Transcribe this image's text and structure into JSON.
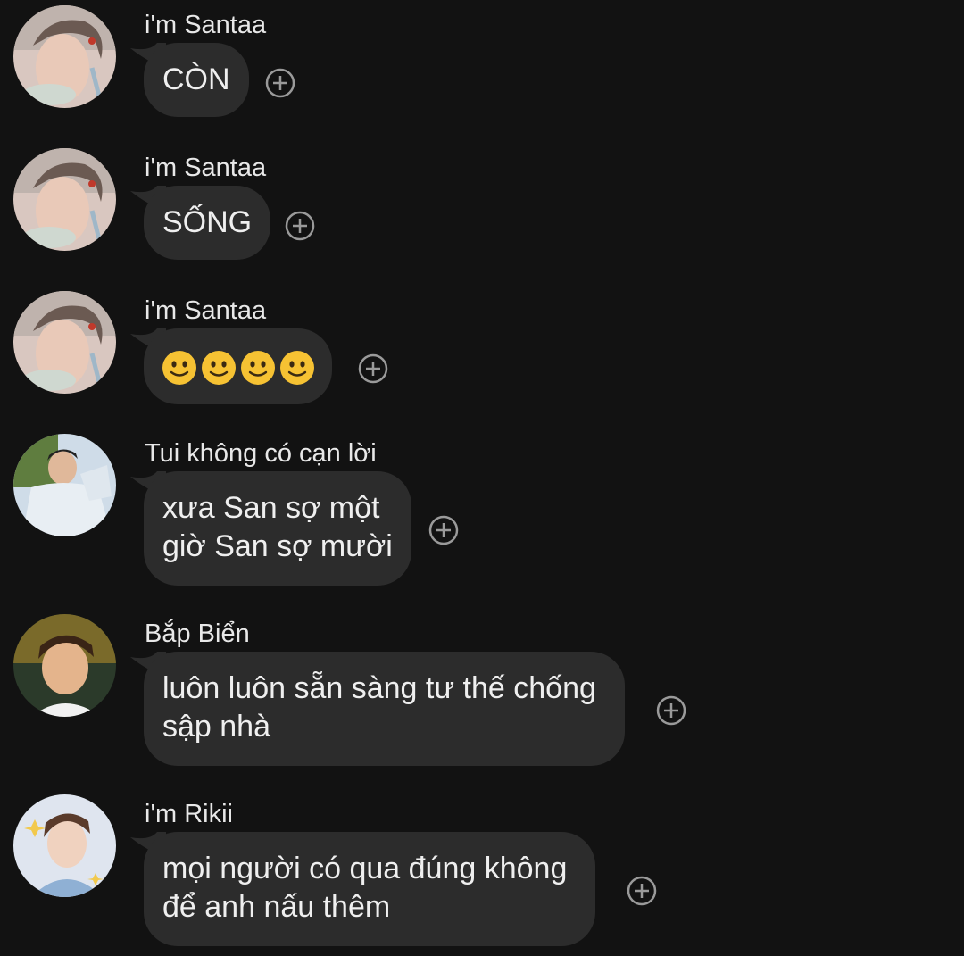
{
  "messages": [
    {
      "sender": "i'm Santaa",
      "text": "CÒN",
      "avatar": "santaa-avatar"
    },
    {
      "sender": "i'm Santaa",
      "text": "SỐNG",
      "avatar": "santaa-avatar"
    },
    {
      "sender": "i'm Santaa",
      "text": "🙂🙂🙂🙂",
      "avatar": "santaa-avatar",
      "emoji": "slightly-smiling-face",
      "emoji_count": 4
    },
    {
      "sender": "Tui không có cạn lời",
      "text_lines": [
        "xưa San sợ một",
        "giờ San sợ mười"
      ],
      "avatar": "tui-avatar"
    },
    {
      "sender": "Bắp Biển",
      "text_lines": [
        "luôn luôn sẵn sàng tư thế chống",
        "sập nhà"
      ],
      "avatar": "bap-bien-avatar"
    },
    {
      "sender": "i'm Rikii",
      "text_lines": [
        "mọi người có qua đúng không",
        "để anh nấu thêm"
      ],
      "avatar": "rikii-avatar"
    }
  ],
  "react_icon": "add-reaction-icon",
  "colors": {
    "background": "#121212",
    "bubble": "#2c2c2c",
    "text": "#efefef",
    "react_icon": "#9a9a9a"
  }
}
